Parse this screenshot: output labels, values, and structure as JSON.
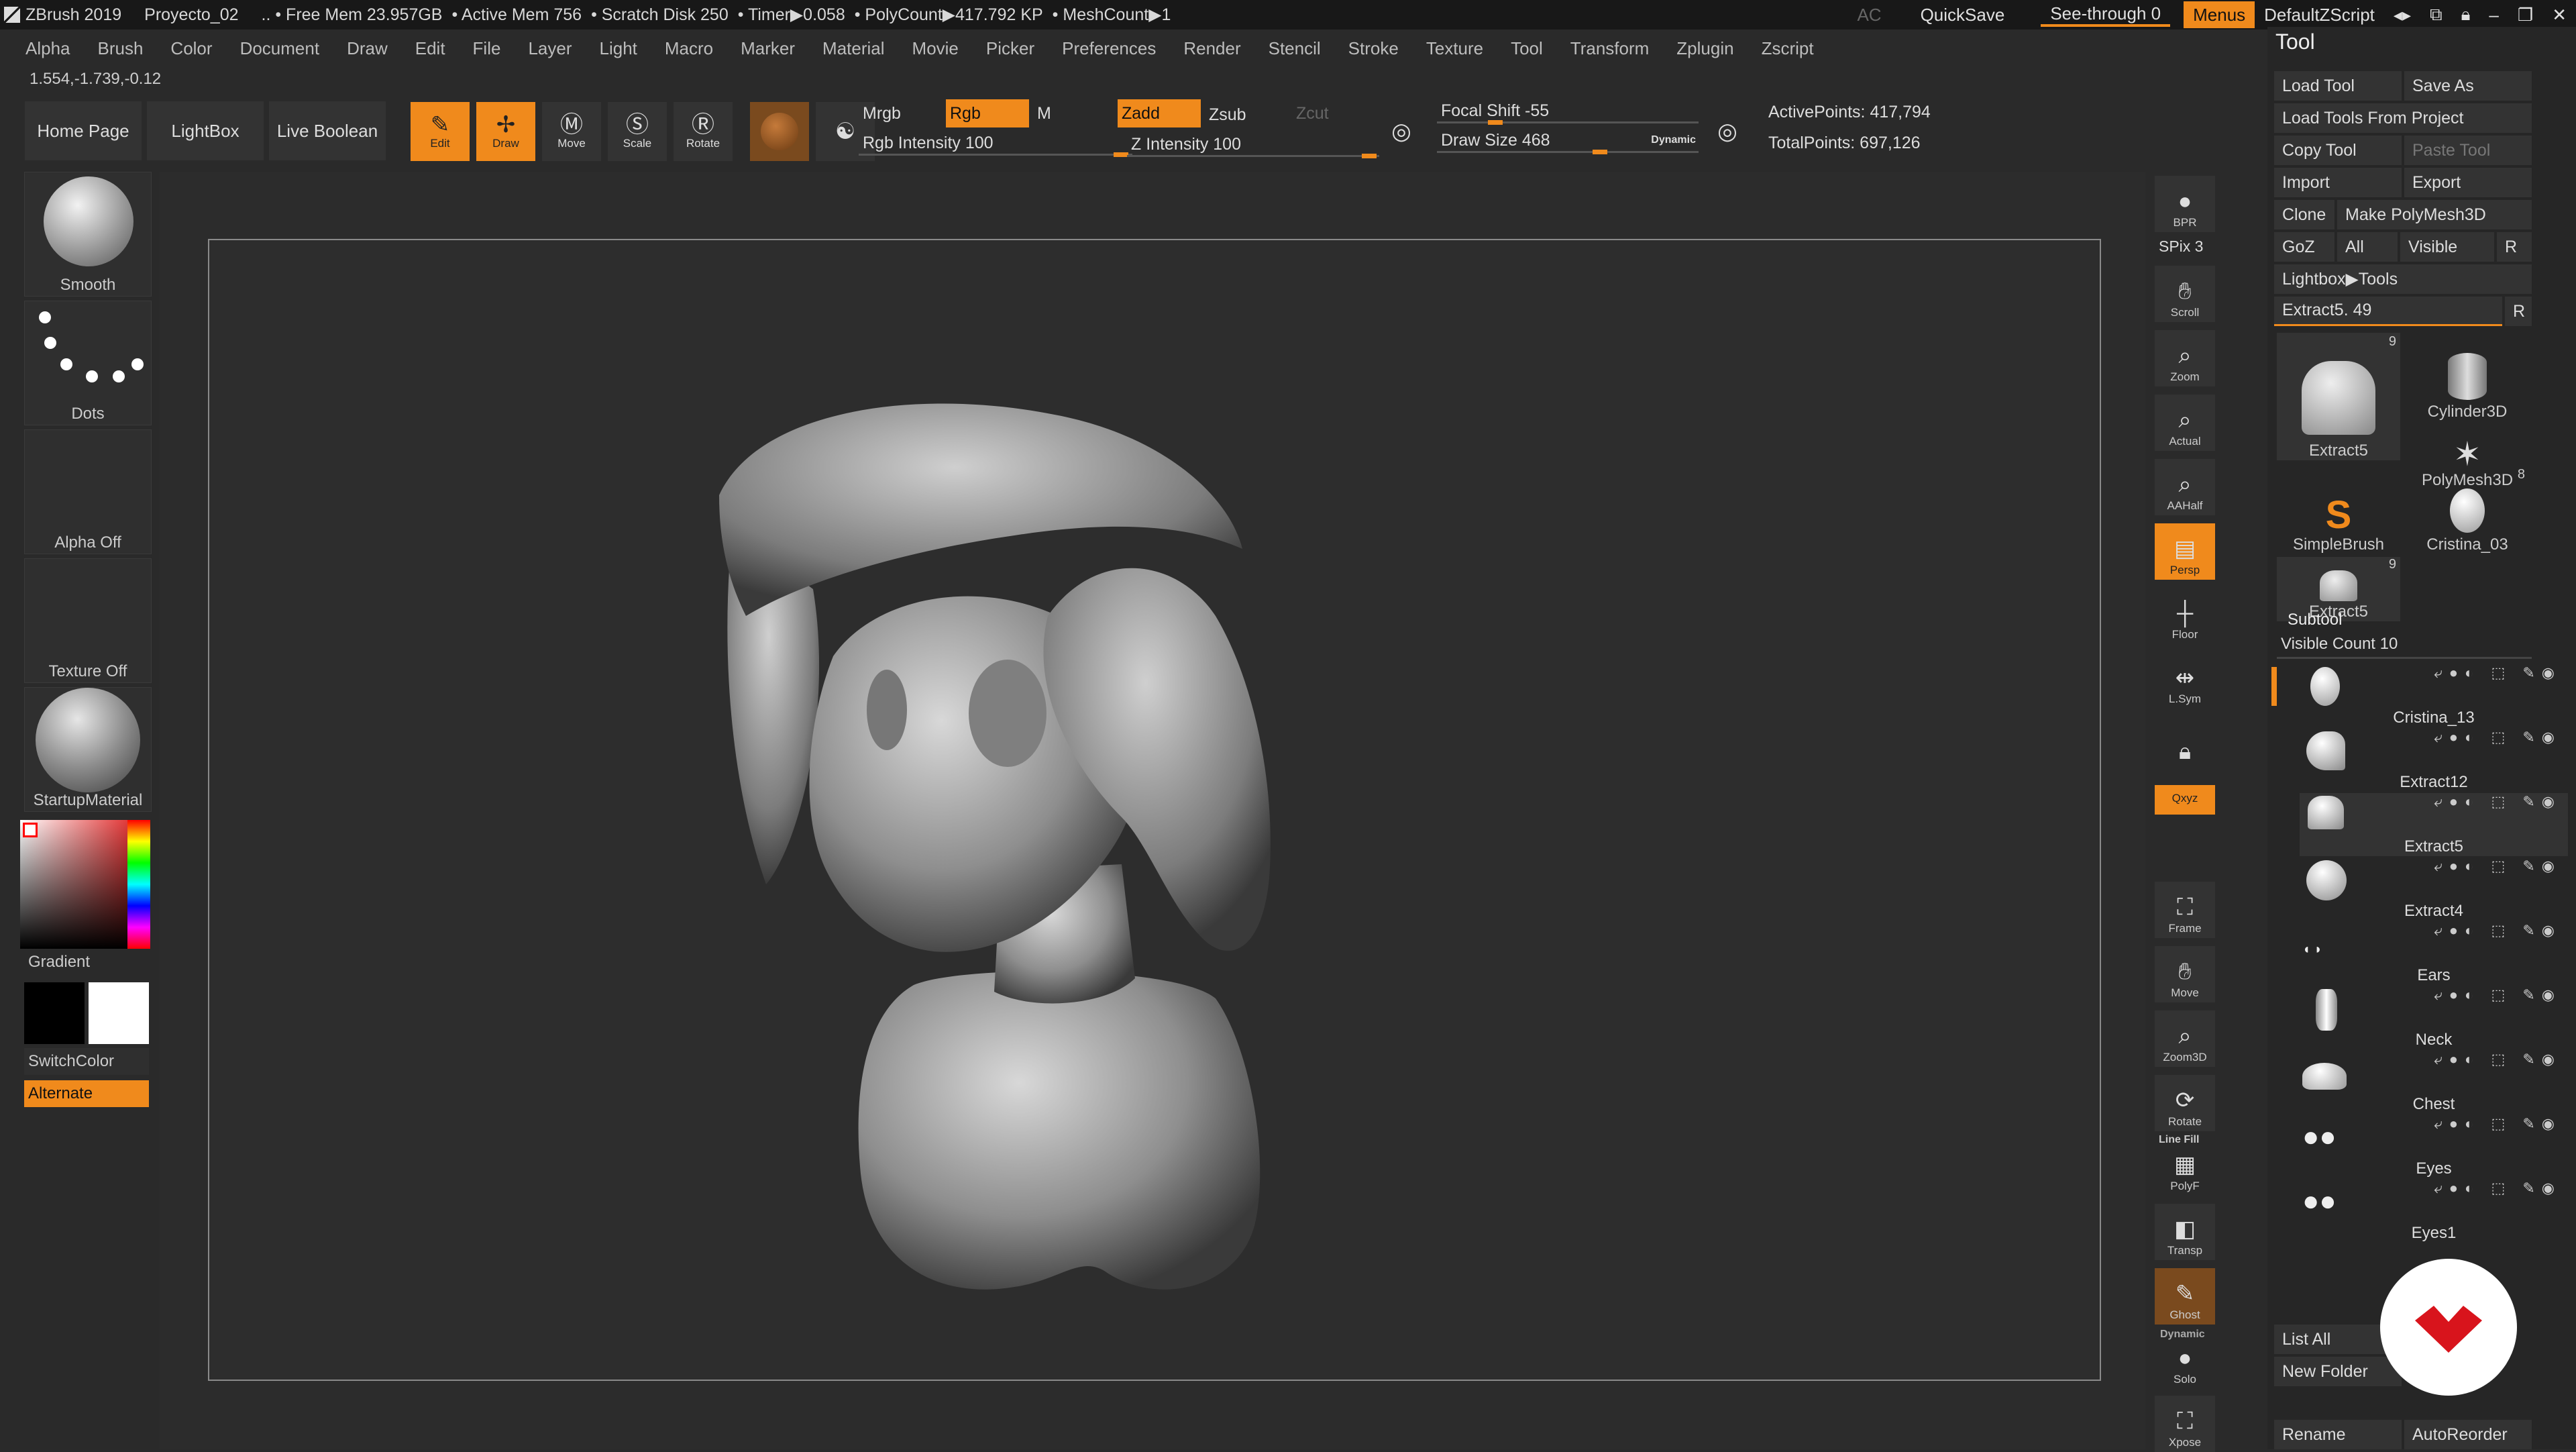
{
  "titlebar": {
    "app": "ZBrush 2019",
    "project": "Proyecto_02",
    "free_mem": ".. • Free Mem 23.957GB",
    "active_mem": "• Active Mem 756",
    "scratch": "• Scratch Disk 250",
    "timer": "• Timer▶0.058",
    "polycount": "• PolyCount▶417.792 KP",
    "meshcount": "• MeshCount▶1",
    "ac": "AC",
    "quicksave": "QuickSave",
    "seethrough": "See-through  0",
    "menus": "Menus",
    "script": "DefaultZScript"
  },
  "menubar": [
    "Alpha",
    "Brush",
    "Color",
    "Document",
    "Draw",
    "Edit",
    "File",
    "Layer",
    "Light",
    "Macro",
    "Marker",
    "Material",
    "Movie",
    "Picker",
    "Preferences",
    "Render",
    "Stencil",
    "Stroke",
    "Texture",
    "Tool",
    "Transform",
    "Zplugin",
    "Zscript"
  ],
  "coords": "1.554,-1.739,-0.12",
  "toolbar": {
    "home": "Home Page",
    "lightbox": "LightBox",
    "liveboolean": "Live Boolean",
    "edit": "Edit",
    "draw": "Draw",
    "move": "Move",
    "scale": "Scale",
    "rotate": "Rotate",
    "mrgb": "Mrgb",
    "rgb": "Rgb",
    "m": "M",
    "rgb_intensity": "Rgb Intensity 100",
    "zadd": "Zadd",
    "zsub": "Zsub",
    "zcut": "Zcut",
    "z_intensity": "Z Intensity 100",
    "focal": "Focal Shift -55",
    "drawsize": "Draw Size 468",
    "dynamic": "Dynamic",
    "active_points": "ActivePoints: 417,794",
    "total_points": "TotalPoints: 697,126",
    "rgb_intensity_value": 100,
    "z_intensity_value": 100
  },
  "left": {
    "brush": "Smooth",
    "stroke": "Dots",
    "alpha": "Alpha Off",
    "texture": "Texture Off",
    "material": "StartupMaterial",
    "gradient": "Gradient",
    "switchcolor": "SwitchColor",
    "alternate": "Alternate"
  },
  "shelf": [
    "BPR",
    "Scroll",
    "Zoom",
    "Actual",
    "AAHalf",
    "Persp",
    "Floor",
    "L.Sym",
    "Frame",
    "Move",
    "Zoom3D",
    "Rotate",
    "PolyF",
    "Transp",
    "Ghost",
    "Solo",
    "Xpose"
  ],
  "shelf_extra": {
    "spix": "SPix 3",
    "xyz": "Qxyz",
    "dynamic": "Dynamic",
    "linefill": "Line Fill"
  },
  "tool": {
    "title": "Tool",
    "load": "Load Tool",
    "saveas": "Save As",
    "loadproj": "Load Tools From Project",
    "copy": "Copy Tool",
    "paste": "Paste Tool",
    "import": "Import",
    "export": "Export",
    "clone": "Clone",
    "makepoly": "Make PolyMesh3D",
    "goz": "GoZ",
    "all": "All",
    "visible": "Visible",
    "r": "R",
    "lightbox_tools": "Lightbox▶Tools",
    "extract_slider": "Extract5. 49",
    "items": [
      {
        "name": "Extract5",
        "count": "9"
      },
      {
        "name": "Cylinder3D",
        "count": ""
      },
      {
        "name": "PolyMesh3D",
        "count": ""
      },
      {
        "name": "SimpleBrush",
        "count": ""
      },
      {
        "name": "Cristina_03",
        "count": "8"
      },
      {
        "name": "Extract5",
        "count": "9"
      }
    ],
    "subtool": "Subtool",
    "visible_count": "Visible Count 10",
    "subtools": [
      "Cristina_13",
      "Extract12",
      "Extract5",
      "Extract4",
      "Ears",
      "Neck",
      "Chest",
      "Eyes",
      "Eyes1"
    ],
    "listall": "List All",
    "newfolder": "New Folder",
    "rename": "Rename",
    "autoreorder": "AutoReorder"
  },
  "colors": {
    "accent": "#f08a1c",
    "bg": "#2a2a2a"
  }
}
